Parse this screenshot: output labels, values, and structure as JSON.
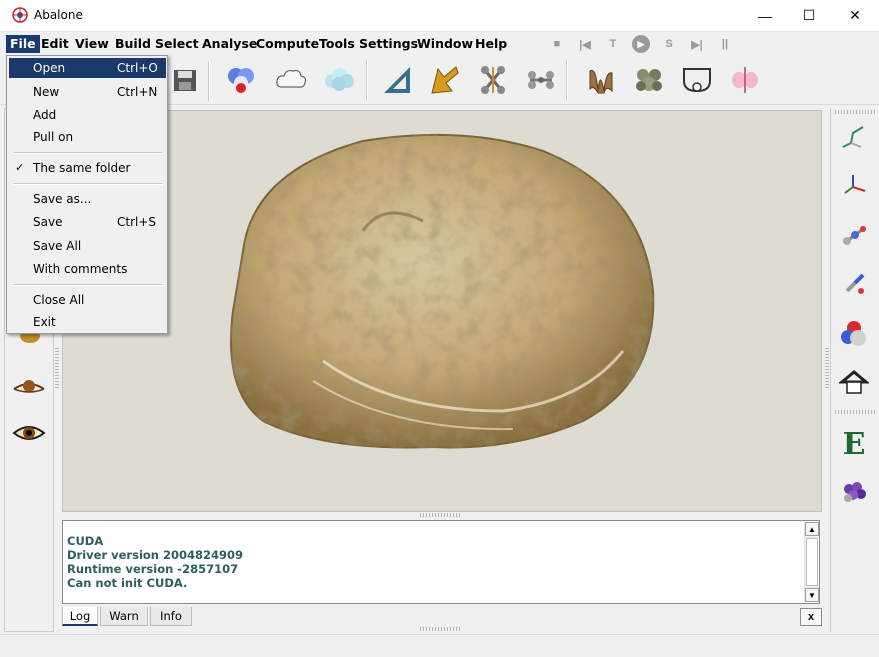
{
  "window": {
    "title": "Abalone",
    "minimize": "—",
    "maximize": "☐",
    "close": "✕"
  },
  "menu": [
    "File",
    "Edit",
    "View",
    "Build",
    "Select",
    "Analyse",
    "Compute",
    "Tools",
    "Settings",
    "Window",
    "Help"
  ],
  "play_controls": [
    "■",
    "|◀",
    "T",
    "▶",
    "S",
    "▶|",
    "||"
  ],
  "file_menu": {
    "open": {
      "label": "Open",
      "shortcut": "Ctrl+O"
    },
    "new": {
      "label": "New",
      "shortcut": "Ctrl+N"
    },
    "add": {
      "label": "Add"
    },
    "pull_on": {
      "label": "Pull on"
    },
    "same_folder": {
      "label": "The same folder",
      "check": "✓"
    },
    "save_as": {
      "label": "Save as..."
    },
    "save": {
      "label": "Save",
      "shortcut": "Ctrl+S"
    },
    "save_all": {
      "label": "Save All"
    },
    "with_comments": {
      "label": "With comments"
    },
    "close_all": {
      "label": "Close All"
    },
    "exit": {
      "label": "Exit"
    }
  },
  "log": {
    "lines": [
      "CUDA",
      "Driver version 2004824909",
      "Runtime version -2857107",
      "Can not init CUDA."
    ],
    "text_color": "#2e5e5e"
  },
  "tabs": [
    "Log",
    "Warn",
    "Info"
  ],
  "log_close": "x",
  "right_panel": {
    "e_label": "E"
  },
  "colors": {
    "menu_highlight": "#1a3a6b",
    "background": "#f0f0f0",
    "viewport": "#dcdcd2"
  }
}
